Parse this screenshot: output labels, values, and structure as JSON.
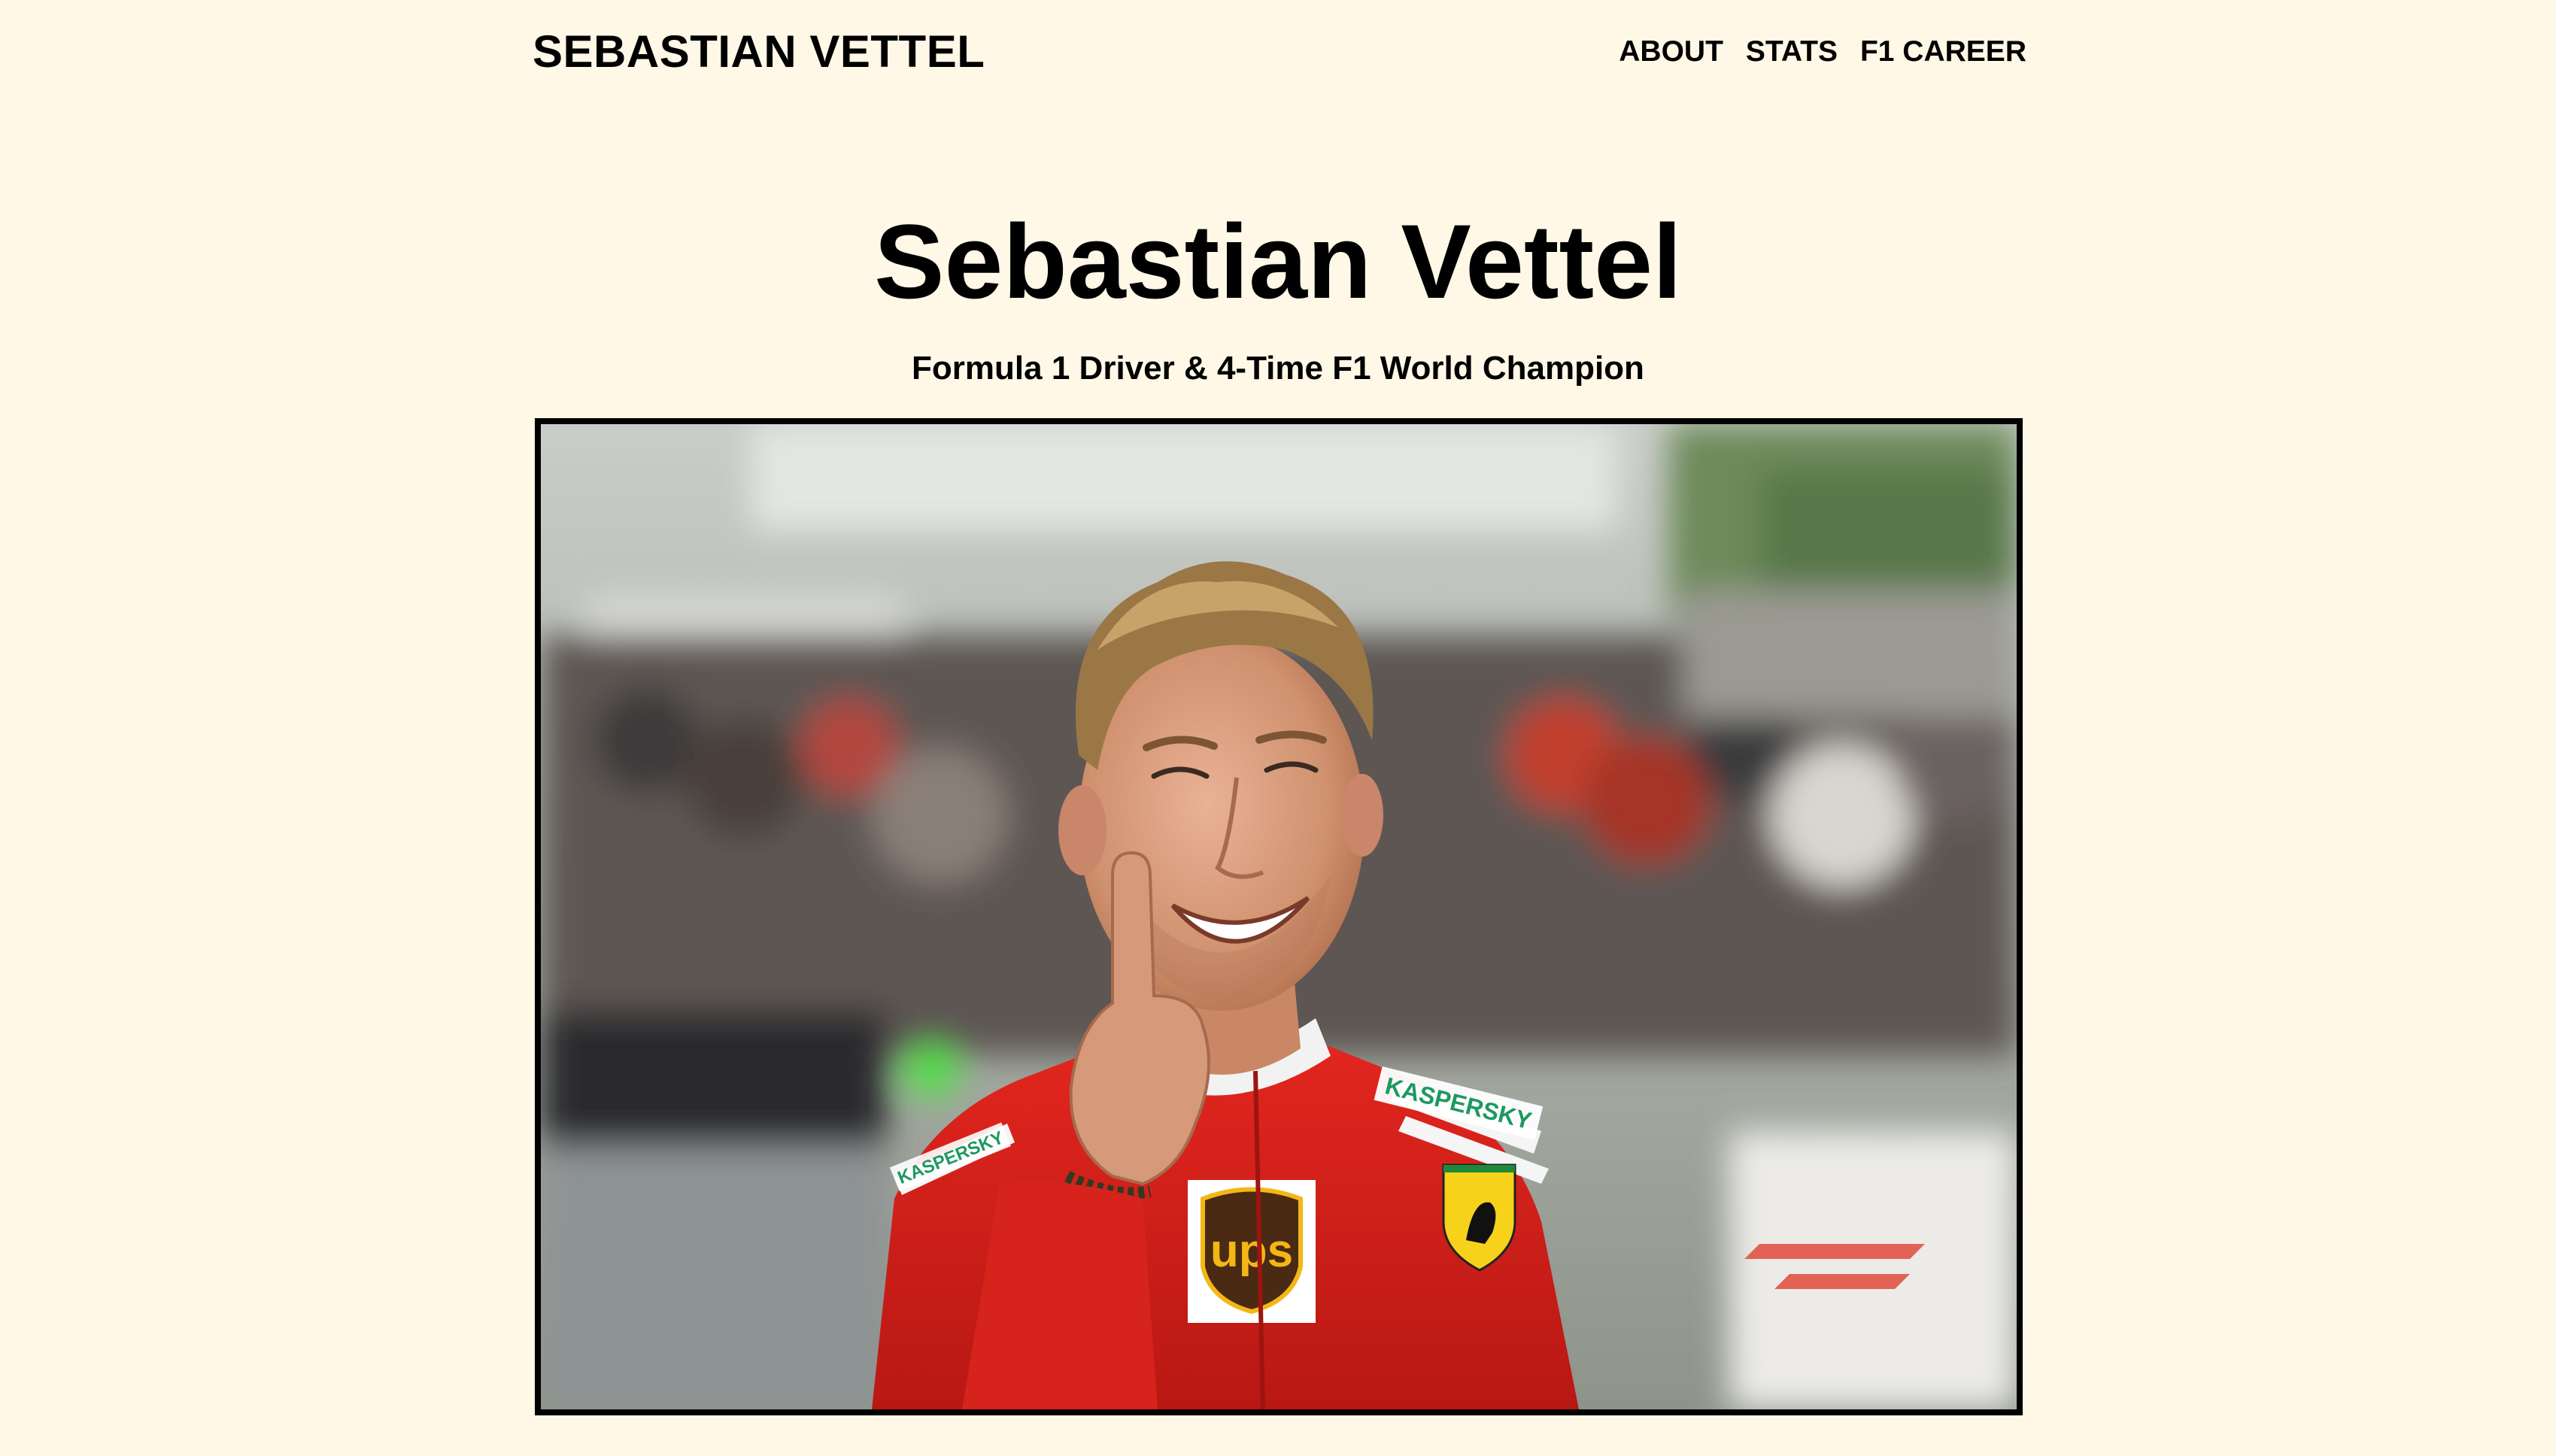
{
  "header": {
    "brand": "SEBASTIAN VETTEL",
    "nav": [
      {
        "label": "ABOUT"
      },
      {
        "label": "STATS"
      },
      {
        "label": "F1 CAREER"
      }
    ]
  },
  "hero": {
    "title": "Sebastian Vettel",
    "subtitle": "Formula 1 Driver & 4-Time F1 World Champion"
  },
  "photo": {
    "subject": "Sebastian Vettel smiling in red Ferrari race suit, index finger raised",
    "suit_logos": [
      "KASPERSKY",
      "UPS",
      "Ferrari prancing horse"
    ]
  },
  "colors": {
    "background": "#fff8e7",
    "text": "#000000",
    "frame_border": "#000000",
    "ferrari_red": "#d8201c"
  }
}
